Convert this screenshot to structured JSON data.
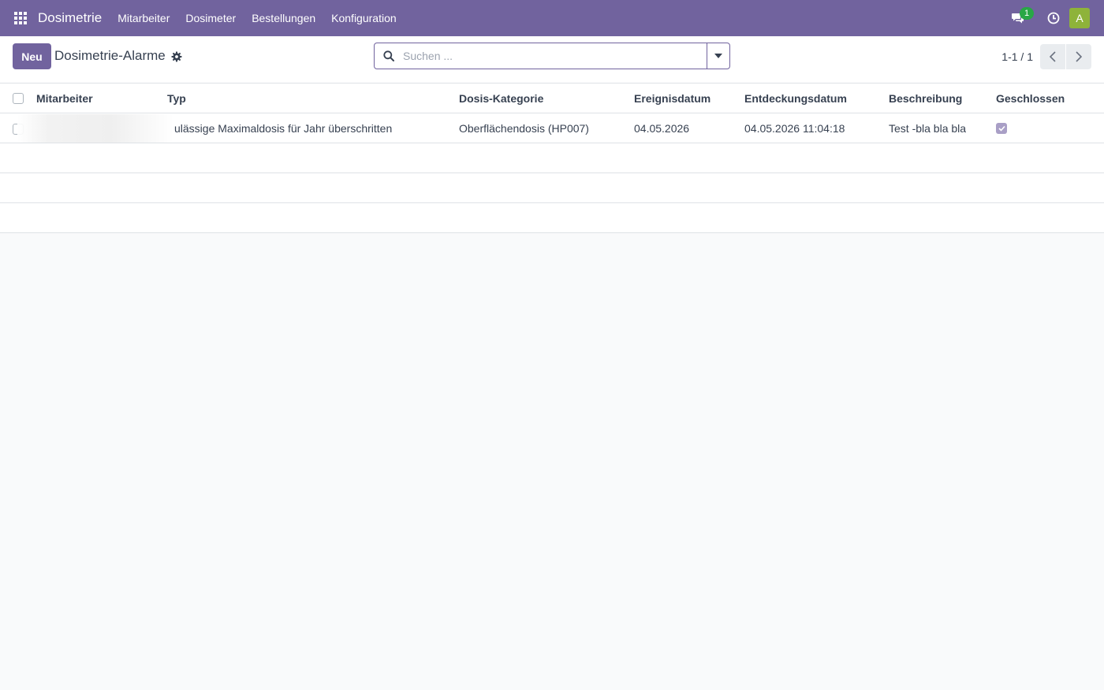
{
  "navbar": {
    "app_name": "Dosimetrie",
    "menu": [
      "Mitarbeiter",
      "Dosimeter",
      "Bestellungen",
      "Konfiguration"
    ],
    "chat_badge": "1",
    "avatar_letter": "A"
  },
  "control_panel": {
    "new_label": "Neu",
    "title": "Dosimetrie-Alarme",
    "search_placeholder": "Suchen ...",
    "pager": "1-1 / 1"
  },
  "table": {
    "columns": {
      "employee": "Mitarbeiter",
      "type": "Typ",
      "dose_category": "Dosis-Kategorie",
      "event_date": "Ereignisdatum",
      "discovery_date": "Entdeckungsdatum",
      "description": "Beschreibung",
      "closed": "Geschlossen"
    },
    "rows": [
      {
        "employee": "",
        "type": "ulässige Maximaldosis für Jahr überschritten",
        "dose_category": "Oberflächendosis (HP007)",
        "event_date": "04.05.2026",
        "discovery_date": "04.05.2026 11:04:18",
        "description": "Test -bla bla bla",
        "closed": true
      }
    ]
  },
  "colors": {
    "brand": "#71639e",
    "badge": "#28a745",
    "avatar": "#8eb33a"
  },
  "icons": [
    "apps-grid-icon",
    "chat-icon",
    "clock-icon",
    "gear-icon",
    "search-icon",
    "caret-down-icon",
    "chevron-left-icon",
    "chevron-right-icon",
    "check-icon"
  ]
}
